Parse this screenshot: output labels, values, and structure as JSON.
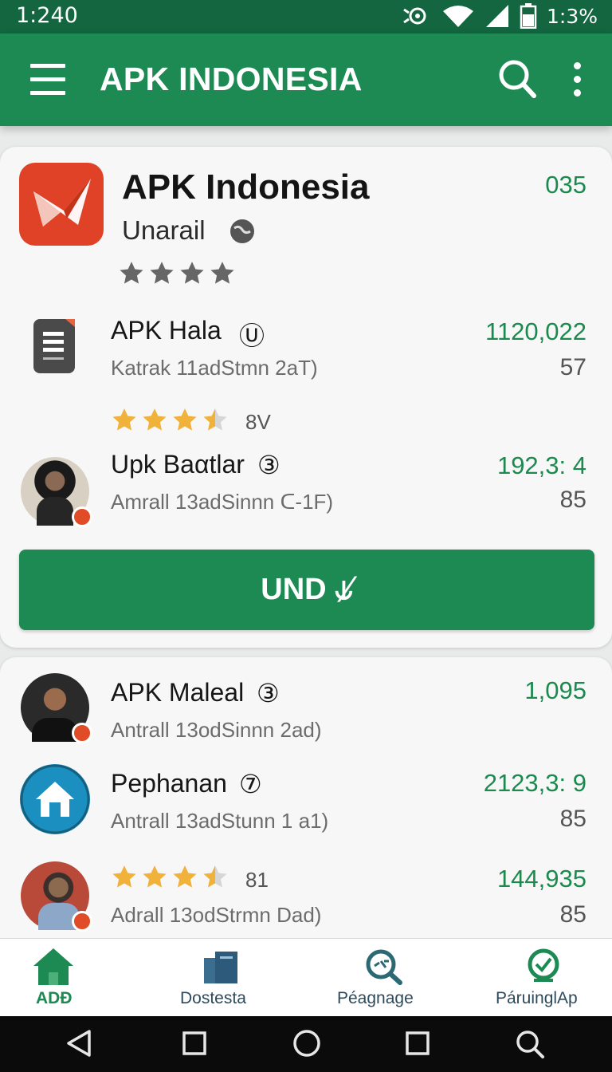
{
  "status_bar": {
    "time": "1:240",
    "battery_text": "1:3%"
  },
  "app_bar": {
    "title": "APK INDONESIA"
  },
  "featured": {
    "title": "APK Indonesia",
    "subtitle": "Unarail",
    "count": "035",
    "stars": 4
  },
  "card1_items": [
    {
      "name": "APK Hala",
      "badge_glyph": "Ⓤ",
      "sub": "Katrak 11adStmn 2aT)",
      "primary": "1120,022",
      "secondary": "57",
      "rating_text": "8V",
      "stars": 3.5
    },
    {
      "name": "Upk Baαtlar",
      "badge_glyph": "③",
      "sub": "Amrall 13adSinnn ᑕ-1F)",
      "primary": "192,3: 4",
      "secondary": "85"
    }
  ],
  "install_button": {
    "label": "UND ⫝̸"
  },
  "card2_items": [
    {
      "name": "APK Maleal",
      "badge_glyph": "③",
      "sub": "Antrall 13odSinnn 2ad)",
      "primary": "1,095"
    },
    {
      "name": "Pephanan",
      "badge_glyph": "⑦",
      "sub": "Antrall 13adStunn 1 a1)",
      "primary": "2123,3: 9",
      "secondary": "85"
    },
    {
      "rating_text": "81",
      "stars": 3.5,
      "sub": "Adrall 13odStrmn Dad)",
      "primary": "144,935",
      "secondary": "85"
    }
  ],
  "bottom_nav": [
    {
      "label": "ADĐ",
      "icon": "home-icon",
      "active": true
    },
    {
      "label": "Dostesta",
      "icon": "documents-icon"
    },
    {
      "label": "Péagnage",
      "icon": "search-zoom-icon"
    },
    {
      "label": "PáruinglAp",
      "icon": "search-check-icon"
    }
  ],
  "colors": {
    "primary": "#1c8a52",
    "status": "#13663f",
    "star_gold": "#f0b23a",
    "star_grey": "#6b6b6b",
    "accent_red": "#e14c28"
  }
}
